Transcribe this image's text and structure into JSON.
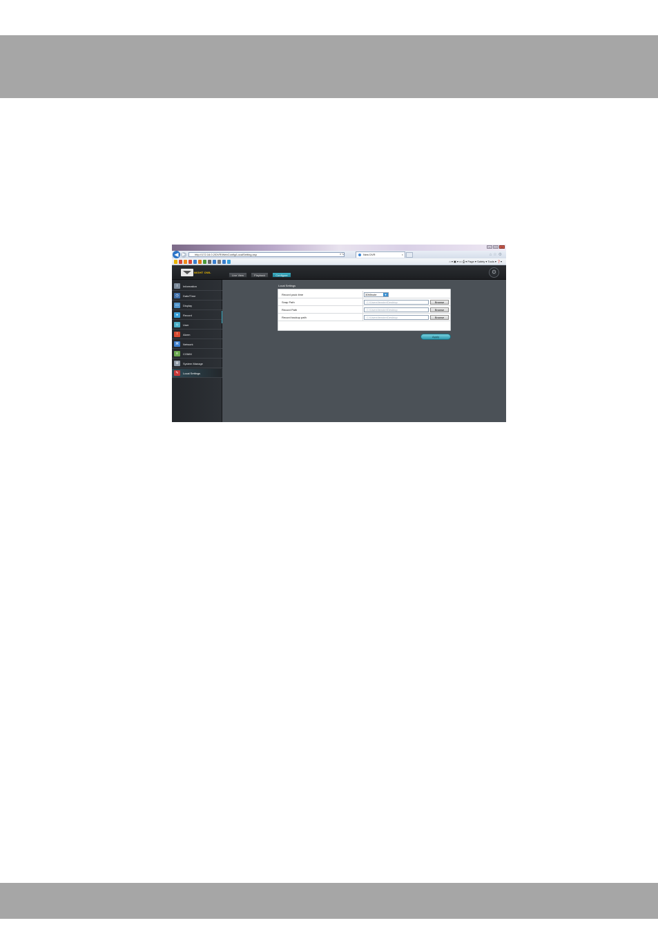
{
  "browser": {
    "url": "http://172.16.0.2/DVR/WebConfig/LocalSetting.asp",
    "tab_title": "New DVR",
    "tab_close": "×",
    "command_bar": "⌂ ▾ ▣ ▾ ▭ ⎙ ▾  Page ▾  Safety ▾  Tools ▾  ❓▾",
    "back_icon": "back-arrow-icon",
    "forward_icon": "forward-arrow-icon"
  },
  "window_controls": {
    "minimize": "–",
    "maximize": "□",
    "close": "×"
  },
  "header": {
    "brand": "NIGHT OWL",
    "tabs": [
      {
        "label": "Live View",
        "active": false
      },
      {
        "label": "Playback",
        "active": false
      },
      {
        "label": "Configure",
        "active": true
      }
    ],
    "power_symbol": "⏻"
  },
  "sidebar": {
    "items": [
      {
        "label": "Information",
        "icon": "info-icon",
        "color": "#7b8a99",
        "glyph": "i"
      },
      {
        "label": "Date/Time",
        "icon": "clock-icon",
        "color": "#3f6fa8",
        "glyph": "◷"
      },
      {
        "label": "Display",
        "icon": "display-icon",
        "color": "#4f93c9",
        "glyph": "▭"
      },
      {
        "label": "Record",
        "icon": "record-icon",
        "color": "#3aa0d8",
        "glyph": "●"
      },
      {
        "label": "User",
        "icon": "user-icon",
        "color": "#4cb0c8",
        "glyph": "☺"
      },
      {
        "label": "Alarm",
        "icon": "alarm-icon",
        "color": "#d84a2f",
        "glyph": "!"
      },
      {
        "label": "Network",
        "icon": "network-icon",
        "color": "#3b7fcf",
        "glyph": "⌘"
      },
      {
        "label": "COMM",
        "icon": "comm-icon",
        "color": "#6aa84f",
        "glyph": "≡"
      },
      {
        "label": "System Manage",
        "icon": "system-manage-icon",
        "color": "#8d99a6",
        "glyph": "⚙"
      },
      {
        "label": "Local Settings",
        "icon": "local-settings-icon",
        "color": "#c93a3a",
        "glyph": "✎",
        "active": true
      }
    ]
  },
  "local_settings": {
    "title": "Local Settings",
    "rows": [
      {
        "label": "Record pack time",
        "type": "select",
        "value": "30Minute",
        "arrow": "▼"
      },
      {
        "label": "Snap Path",
        "type": "path",
        "value": "C:\\Users\\fenster\\Desktop",
        "button": "Browse"
      },
      {
        "label": "Record Path",
        "type": "path",
        "value": "C:\\Users\\fenster\\Desktop",
        "button": "Browse"
      },
      {
        "label": "Record backup path",
        "type": "path",
        "value": "C:\\Users\\fenster\\Desktop",
        "button": "Browse"
      }
    ],
    "apply_label": "Apply"
  },
  "colors": {
    "page_band": "#a6a6a6",
    "content_bg": "#4b5157",
    "accent": "#2f97ac",
    "brand": "#f2c000"
  }
}
